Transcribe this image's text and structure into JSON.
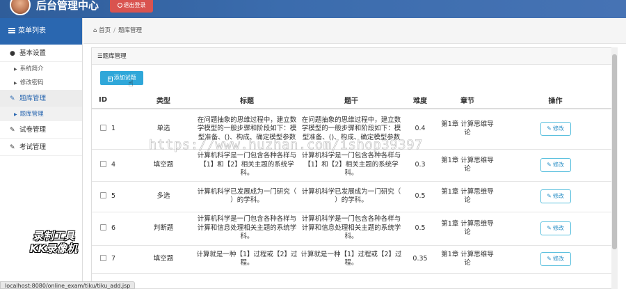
{
  "header": {
    "title": "后台管理中心",
    "logout_label": "退出登录"
  },
  "sidebar": {
    "header_label": "菜单列表",
    "groups": [
      {
        "label": "基本设置",
        "icon": "user-icon",
        "items": [
          "系统简介",
          "修改密码"
        ]
      },
      {
        "label": "题库管理",
        "icon": "edit-icon",
        "items": [
          "题库管理"
        ]
      },
      {
        "label": "试卷管理",
        "icon": "edit-icon",
        "items": []
      },
      {
        "label": "考试管理",
        "icon": "edit-icon",
        "items": []
      }
    ]
  },
  "breadcrumb": {
    "home": "首页",
    "current": "题库管理"
  },
  "panel": {
    "title": "题库管理",
    "add_button_label": "添加试题"
  },
  "table": {
    "columns": [
      "ID",
      "类型",
      "标题",
      "题干",
      "难度",
      "章节",
      "操作"
    ],
    "edit_label": "修改",
    "rows": [
      {
        "id": "1",
        "type": "单选",
        "title": "在问题抽象的思维过程中，建立数学模型的一般步骤和阶段如下：模型准备、()、构成、确定模型参数",
        "stem": "在问题抽象的思维过程中，建立数学模型的一般步骤和阶段如下：模型准备、()、构成、确定模型参数",
        "difficulty": "0.4",
        "chapter": "第1章 计算思维导论"
      },
      {
        "id": "4",
        "type": "填空题",
        "title": "计算机科学是一门包含各种各样与【1】和【2】相关主题的系统学科。",
        "stem": "计算机科学是一门包含各种各样与【1】和【2】相关主题的系统学科。",
        "difficulty": "0.3",
        "chapter": "第1章 计算思维导论"
      },
      {
        "id": "5",
        "type": "多选",
        "title": "计算机科学已发展成为一门研究（ ）的学科。",
        "stem": "计算机科学已发展成为一门研究（ ）的学科。",
        "difficulty": "0.5",
        "chapter": "第1章 计算思维导论"
      },
      {
        "id": "6",
        "type": "判断题",
        "title": "计算机科学是一门包含各种各样与计算和信息处理相关主题的系统学科。",
        "stem": "计算机科学是一门包含各种各样与计算和信息处理相关主题的系统学科。",
        "difficulty": "0.5",
        "chapter": "第1章 计算思维导论"
      },
      {
        "id": "7",
        "type": "填空题",
        "title": "计算就是一种【1】过程或【2】过程。",
        "stem": "计算就是一种【1】过程或【2】过程。",
        "difficulty": "0.35",
        "chapter": "第1章 计算思维导论"
      }
    ]
  },
  "status_bar": {
    "url": "localhost:8080/online_exam/tiku/tiku_add.jsp"
  },
  "watermarks": {
    "url_text": "https://www.huzhan.com/ishop39397",
    "tool_text_1": "录制工具",
    "tool_text_2": "KK录像机"
  }
}
